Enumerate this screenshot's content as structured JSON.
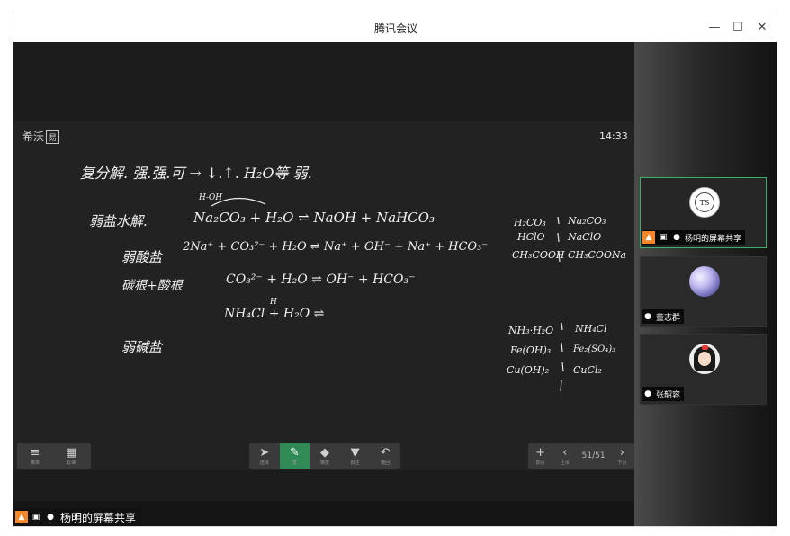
{
  "window": {
    "title": "腾讯会议",
    "controls": {
      "minimize": "—",
      "maximize": "☐",
      "close": "✕"
    }
  },
  "board": {
    "logo_text": "希沃",
    "logo_badge": "易",
    "time": "14:33"
  },
  "handwriting": {
    "line1": "复分解.  强.强.可 → ↓.↑.  H₂O等 弱.",
    "line2_label": "弱盐水解.",
    "line2_eq": "Na₂CO₃ + H₂O ⇌ NaOH + NaHCO₃",
    "line2_note": "H-OH",
    "line3_label": "弱酸盐",
    "line3_eq": "2Na⁺ + CO₃²⁻ + H₂O ⇌ Na⁺ + OH⁻ + Na⁺ + HCO₃⁻",
    "line4_label": "碳根+酸根",
    "line4_eq": "CO₃²⁻ + H₂O ⇌ OH⁻ + HCO₃⁻",
    "line5_note": "H",
    "line5_eq": "NH₄Cl + H₂O ⇌",
    "line6_label": "弱碱盐",
    "right_col1": [
      "H₂CO₃",
      "HClO",
      "CH₃COOH"
    ],
    "right_col2": [
      "Na₂CO₃",
      "NaClO",
      "CH₃COONa"
    ],
    "right_col3": [
      "NH₃·H₂O",
      "Fe(OH)₃",
      "Cu(OH)₂"
    ],
    "right_col4": [
      "NH₄Cl",
      "Fe₂(SO₄)₃",
      "CuCl₂"
    ]
  },
  "toolbar": {
    "left": [
      {
        "icon": "≡",
        "label": "菜单"
      },
      {
        "icon": "▦",
        "label": "云课"
      }
    ],
    "mid": [
      {
        "icon": "➤",
        "label": "选择"
      },
      {
        "icon": "✎",
        "label": "笔"
      },
      {
        "icon": "◆",
        "label": "橡皮"
      },
      {
        "icon": "▼",
        "label": "批注"
      },
      {
        "icon": "↶",
        "label": "撤回"
      }
    ],
    "right": [
      {
        "icon": "+",
        "label": "加页"
      },
      {
        "icon": "‹",
        "label": "上页"
      },
      {
        "page": "51/51"
      },
      {
        "icon": "›",
        "label": "下页"
      }
    ]
  },
  "presenter": {
    "name": "杨明的屏幕共享"
  },
  "participants": [
    {
      "name": "杨明的屏幕共享",
      "avatar": "TS",
      "active": true
    },
    {
      "name": "董志群",
      "avatar": "moon",
      "active": false
    },
    {
      "name": "张韶容",
      "avatar": "girl",
      "active": false
    }
  ],
  "colors": {
    "accent": "#2f8a56",
    "active_border": "#3fae6a",
    "share_badge": "#f5872a"
  }
}
